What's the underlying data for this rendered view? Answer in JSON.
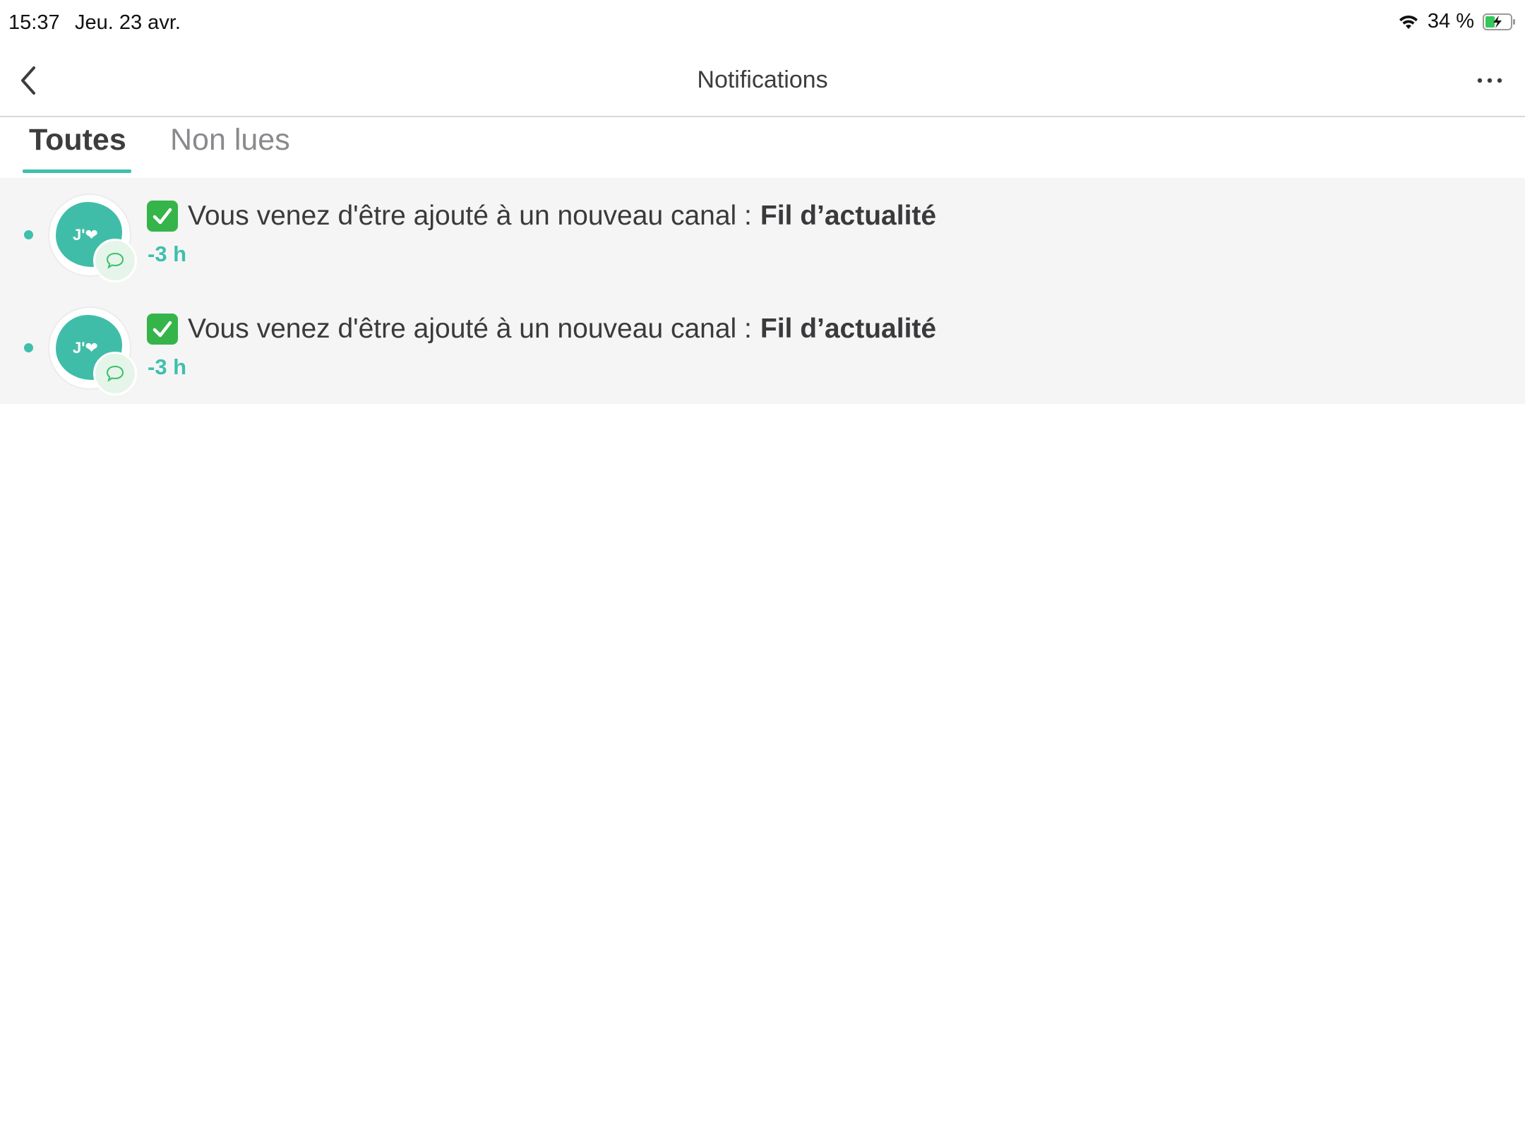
{
  "status_bar": {
    "time": "15:37",
    "date": "Jeu. 23 avr.",
    "battery": "34 %"
  },
  "nav": {
    "title": "Notifications",
    "back_icon": "chevron-left-icon",
    "more_icon": "ellipsis-icon"
  },
  "tabs": [
    {
      "label": "Toutes",
      "active": true
    },
    {
      "label": "Non lues",
      "active": false
    }
  ],
  "notifications": [
    {
      "avatar_text": "J'❤",
      "message": "Vous venez d'être ajouté à un nouveau canal :",
      "channel": "Fil d’actualité",
      "time": "-3 h",
      "unread": true
    },
    {
      "avatar_text": "J'❤",
      "message": "Vous venez d'être ajouté à un nouveau canal :",
      "channel": "Fil d’actualité",
      "time": "-3 h",
      "unread": true
    }
  ],
  "colors": {
    "accent": "#3fbfad",
    "avatar": "#40bda9",
    "check": "#35b44a",
    "list_bg": "#f5f5f5"
  }
}
